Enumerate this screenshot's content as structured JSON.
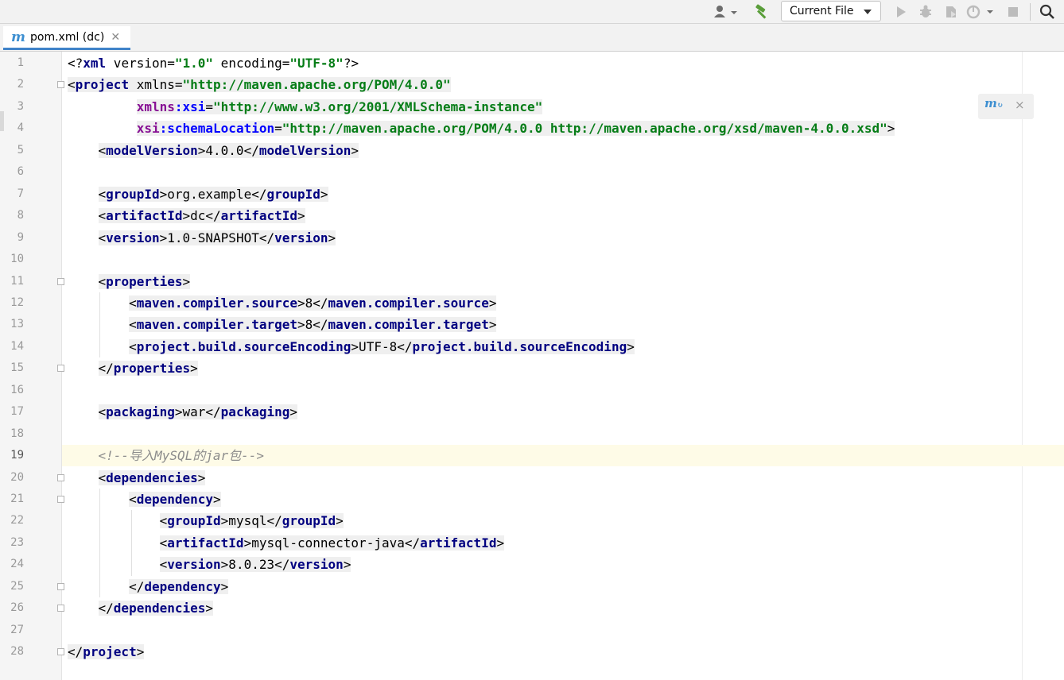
{
  "toolbar": {
    "run_config_label": "Current File",
    "icons": [
      "user-icon",
      "build-hammer-icon",
      "run-icon",
      "debug-icon",
      "coverage-icon",
      "profile-icon",
      "stop-icon",
      "search-icon"
    ],
    "colors": {
      "hammer": "#5a9e3a",
      "disabled": "#bcbcbc"
    }
  },
  "tab": {
    "label": "pom.xml (dc)",
    "icon": "m"
  },
  "notification": {
    "icon": "maven-reload-icon",
    "close": "×"
  },
  "editor": {
    "current_line": 19,
    "lines": [
      {
        "n": "1",
        "text": "<?xml version=\"1.0\" encoding=\"UTF-8\"?>"
      },
      {
        "n": "2",
        "text": "<project xmlns=\"http://maven.apache.org/POM/4.0.0\""
      },
      {
        "n": "3",
        "text": "         xmlns:xsi=\"http://www.w3.org/2001/XMLSchema-instance\""
      },
      {
        "n": "4",
        "text": "         xsi:schemaLocation=\"http://maven.apache.org/POM/4.0.0 http://maven.apache.org/xsd/maven-4.0.0.xsd\">"
      },
      {
        "n": "5",
        "text": "    <modelVersion>4.0.0</modelVersion>"
      },
      {
        "n": "6",
        "text": ""
      },
      {
        "n": "7",
        "text": "    <groupId>org.example</groupId>"
      },
      {
        "n": "8",
        "text": "    <artifactId>dc</artifactId>"
      },
      {
        "n": "9",
        "text": "    <version>1.0-SNAPSHOT</version>"
      },
      {
        "n": "10",
        "text": ""
      },
      {
        "n": "11",
        "text": "    <properties>"
      },
      {
        "n": "12",
        "text": "        <maven.compiler.source>8</maven.compiler.source>"
      },
      {
        "n": "13",
        "text": "        <maven.compiler.target>8</maven.compiler.target>"
      },
      {
        "n": "14",
        "text": "        <project.build.sourceEncoding>UTF-8</project.build.sourceEncoding>"
      },
      {
        "n": "15",
        "text": "    </properties>"
      },
      {
        "n": "16",
        "text": ""
      },
      {
        "n": "17",
        "text": "    <packaging>war</packaging>"
      },
      {
        "n": "18",
        "text": ""
      },
      {
        "n": "19",
        "text": "    <!--导入MySQL的jar包-->"
      },
      {
        "n": "20",
        "text": "    <dependencies>"
      },
      {
        "n": "21",
        "text": "        <dependency>"
      },
      {
        "n": "22",
        "text": "            <groupId>mysql</groupId>"
      },
      {
        "n": "23",
        "text": "            <artifactId>mysql-connector-java</artifactId>"
      },
      {
        "n": "24",
        "text": "            <version>8.0.23</version>"
      },
      {
        "n": "25",
        "text": "        </dependency>"
      },
      {
        "n": "26",
        "text": "    </dependencies>"
      },
      {
        "n": "27",
        "text": ""
      },
      {
        "n": "28",
        "text": "</project>"
      }
    ]
  }
}
